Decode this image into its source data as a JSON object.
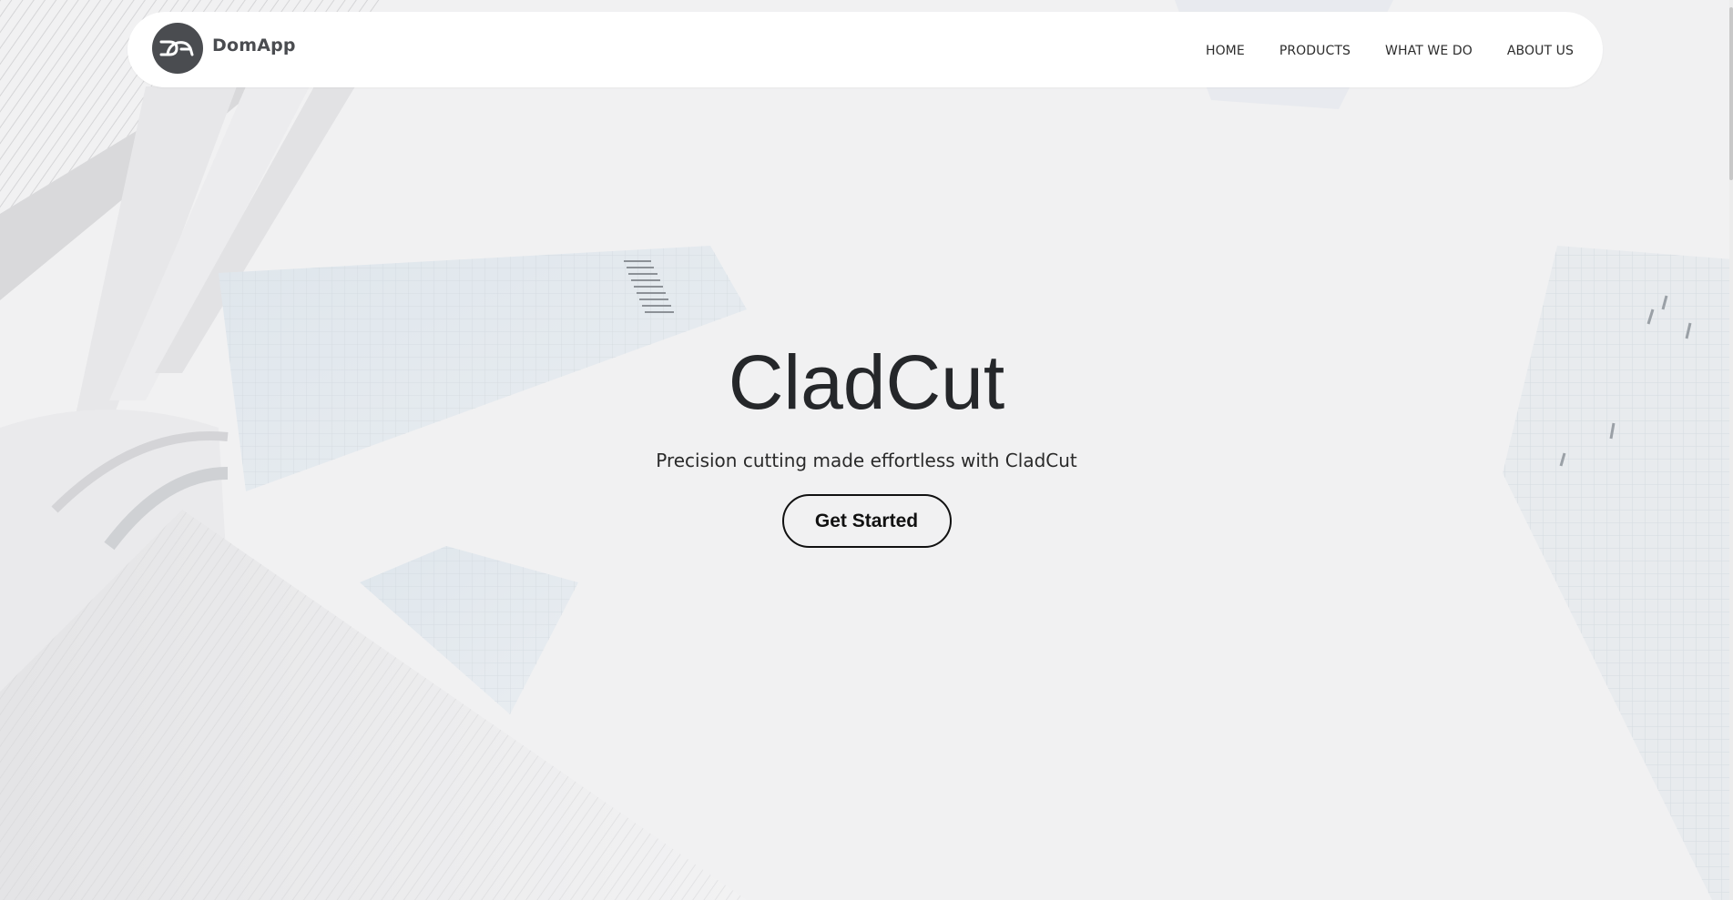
{
  "brand": {
    "logo_text": "DA",
    "name": "DomApp"
  },
  "nav": {
    "items": [
      {
        "label": "HOME"
      },
      {
        "label": "PRODUCTS"
      },
      {
        "label": "WHAT WE DO"
      },
      {
        "label": "ABOUT US"
      }
    ]
  },
  "hero": {
    "title": "CladCut",
    "subtitle": "Precision cutting made effortless with CladCut",
    "cta_label": "Get Started"
  },
  "colors": {
    "background": "#f1f1f2",
    "navbar": "#ffffff",
    "logo": "#4a4c50",
    "text": "#25272a"
  }
}
